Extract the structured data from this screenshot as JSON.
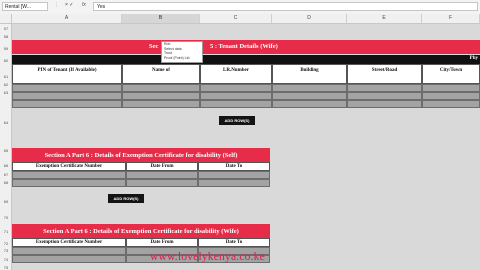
{
  "formula_bar": {
    "name_box": "Rental [W...",
    "dots": "⋮",
    "buttons": "× ✓",
    "fx": "fx",
    "value": "Yes"
  },
  "columns": [
    "A",
    "B",
    "C",
    "D",
    "E",
    "F"
  ],
  "rows": [
    "57",
    "58",
    "59",
    "60",
    "61",
    "62",
    "63",
    "64",
    "65",
    "66",
    "67",
    "68",
    "69",
    "70",
    "71",
    "72",
    "73",
    "74",
    "75"
  ],
  "tenant_wife": {
    "title_left": "Sec",
    "title_right": "5 : Tenant Details (Wife)",
    "right_strip": "Phy",
    "headers": [
      "PIN of Tenant (If Available)",
      "Name of",
      "LR.Number",
      "Building",
      "Street/Road",
      "City/Town"
    ],
    "add_button": "ADD ROW(S)"
  },
  "dropdown": {
    "options": [
      "Rob",
      "Select data",
      "Trust",
      "Proof (Point) Ltd"
    ]
  },
  "exemption_self": {
    "title": "Section A Part 6 : Details of Exemption Certificate for disability (Self)",
    "headers": [
      "Exemption Certificate Number",
      "Date From",
      "Date To"
    ],
    "add_button": "ADD ROW(S)"
  },
  "exemption_wife": {
    "title": "Section A Part 6 : Details of Exemption Certificate for disability (Wife)",
    "headers": [
      "Exemption Certificate Number",
      "Date From",
      "Date To"
    ]
  },
  "watermark": "www.lovelykenya.co.ke"
}
